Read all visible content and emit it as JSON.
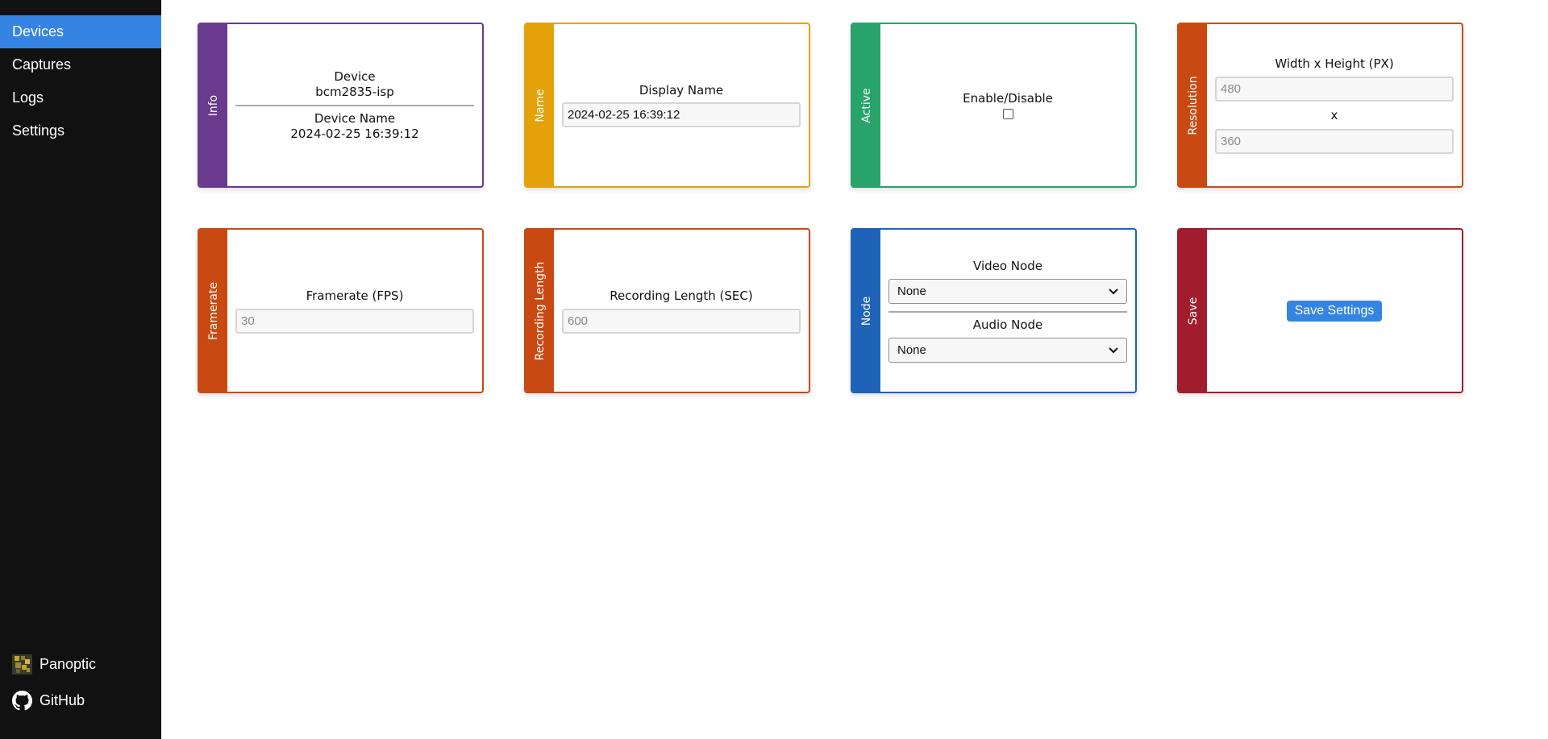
{
  "sidebar": {
    "items": [
      {
        "label": "Devices",
        "active": true
      },
      {
        "label": "Captures"
      },
      {
        "label": "Logs"
      },
      {
        "label": "Settings"
      }
    ],
    "bottom": [
      {
        "label": "Panoptic",
        "icon": "panoptic-logo-icon"
      },
      {
        "label": "GitHub",
        "icon": "github-icon"
      }
    ]
  },
  "colors": {
    "sidebar_bg": "#111111",
    "active": "#3584e4",
    "info": "#6a3a8e",
    "name": "#e3a20a",
    "active_card": "#27a36b",
    "resolution": "#c84a12",
    "framerate": "#c84a12",
    "recording": "#c84a12",
    "node": "#1f63b8",
    "save": "#a11c2d"
  },
  "cards": {
    "info": {
      "tab": "Info",
      "device_label": "Device",
      "device_value": "bcm2835-isp",
      "device_name_label": "Device Name",
      "device_name_value": "2024-02-25 16:39:12"
    },
    "name": {
      "tab": "Name",
      "label": "Display Name",
      "value": "2024-02-25 16:39:12"
    },
    "active": {
      "tab": "Active",
      "label": "Enable/Disable",
      "checked": false
    },
    "resolution": {
      "tab": "Resolution",
      "label": "Width x Height (PX)",
      "width_placeholder": "480",
      "separator": "x",
      "height_placeholder": "360"
    },
    "framerate": {
      "tab": "Framerate",
      "label": "Framerate (FPS)",
      "placeholder": "30"
    },
    "recording": {
      "tab": "Recording Length",
      "label": "Recording Length (SEC)",
      "placeholder": "600"
    },
    "node": {
      "tab": "Node",
      "video_label": "Video Node",
      "video_value": "None",
      "audio_label": "Audio Node",
      "audio_value": "None"
    },
    "save": {
      "tab": "Save",
      "button": "Save Settings"
    }
  }
}
